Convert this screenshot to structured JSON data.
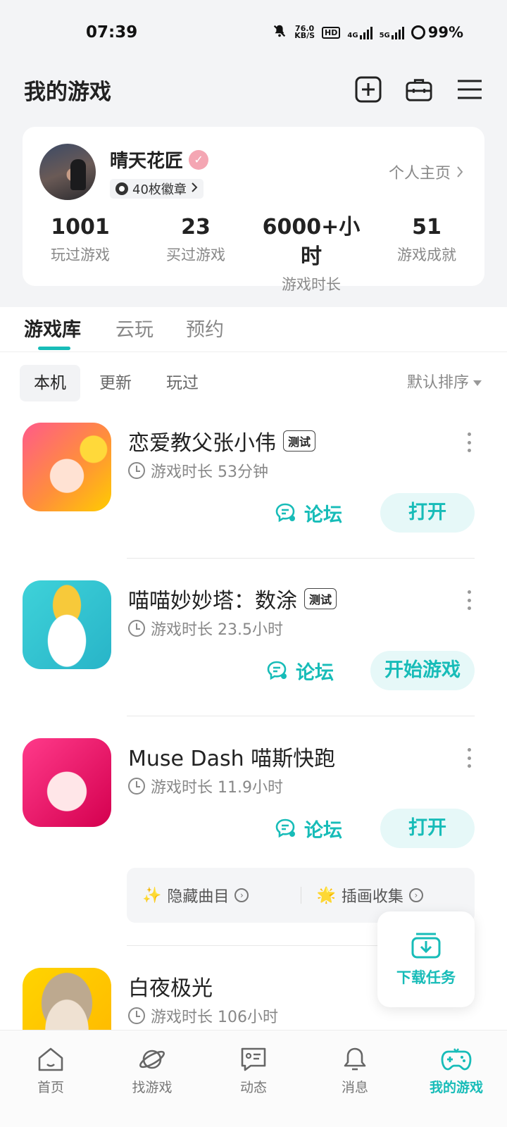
{
  "status_bar": {
    "time": "07:39",
    "net_speed_value": "76.0",
    "net_speed_unit": "KB/S",
    "hd": "HD",
    "sig1": "4G",
    "sig2": "5G",
    "battery": "99%"
  },
  "header": {
    "title": "我的游戏"
  },
  "profile": {
    "name": "晴天花匠",
    "badges": "40枚徽章",
    "homepage": "个人主页",
    "stats": [
      {
        "value": "1001",
        "label": "玩过游戏"
      },
      {
        "value": "23",
        "label": "买过游戏"
      },
      {
        "value": "6000+小时",
        "label": "游戏时长"
      },
      {
        "value": "51",
        "label": "游戏成就"
      }
    ]
  },
  "tabs": [
    "游戏库",
    "云玩",
    "预约"
  ],
  "filters": {
    "items": [
      "本机",
      "更新",
      "玩过"
    ],
    "sort": "默认排序"
  },
  "games": [
    {
      "title": "恋爱教父张小伟",
      "tag": "测试",
      "playtime": "游戏时长 53分钟",
      "forum": "论坛",
      "action": "打开"
    },
    {
      "title": "喵喵妙妙塔：数涂",
      "tag": "测试",
      "playtime": "游戏时长 23.5小时",
      "forum": "论坛",
      "action": "开始游戏"
    },
    {
      "title": "Muse Dash 喵斯快跑",
      "tag": "",
      "playtime": "游戏时长 11.9小时",
      "forum": "论坛",
      "action": "打开"
    },
    {
      "title": "白夜极光",
      "tag": "",
      "playtime": "游戏时长 106小时",
      "forum": "",
      "action": ""
    }
  ],
  "extras": [
    "隐藏曲目",
    "插画收集"
  ],
  "download_task": "下载任务",
  "bottom_nav": [
    "首页",
    "找游戏",
    "动态",
    "消息",
    "我的游戏"
  ],
  "colors": {
    "accent": "#17bcb8",
    "accent_bg": "#e6f8f8"
  }
}
